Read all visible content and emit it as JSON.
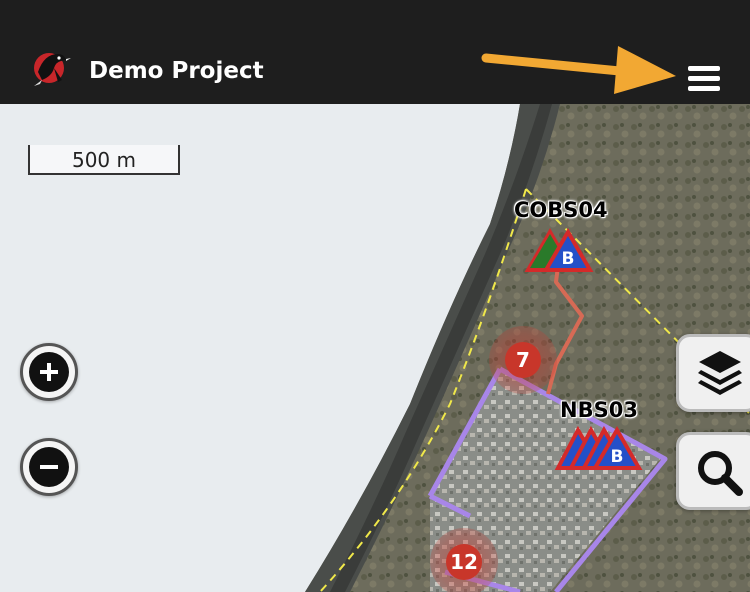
{
  "header": {
    "title": "Demo Project",
    "menu_icon": "hamburger-menu-icon",
    "logo_icon": "bird-logo-icon",
    "background": "#1e1e1e"
  },
  "annotation": {
    "arrow_color": "#f2a833",
    "points_to": "menu-button"
  },
  "map": {
    "scale_label": "500 m",
    "sites": [
      {
        "name": "COBS04",
        "marker_letter": "B",
        "marker_count": 2
      },
      {
        "name": "NBS03",
        "marker_letter": "B",
        "marker_count": 4
      }
    ],
    "clusters": [
      {
        "count": "7"
      },
      {
        "count": "12"
      }
    ],
    "colors": {
      "sea": "#e8ecef",
      "boundary_dashed": "#f0e84a",
      "survey_area": "#a886e8",
      "transect": "#d66a55",
      "cluster": "#c8362a",
      "marker_fill": "#2450c8",
      "marker_outline": "#d42a2a"
    }
  },
  "controls": {
    "zoom_in_icon": "plus-icon",
    "zoom_out_icon": "minus-icon",
    "layers_icon": "layers-icon",
    "search_icon": "search-icon"
  }
}
